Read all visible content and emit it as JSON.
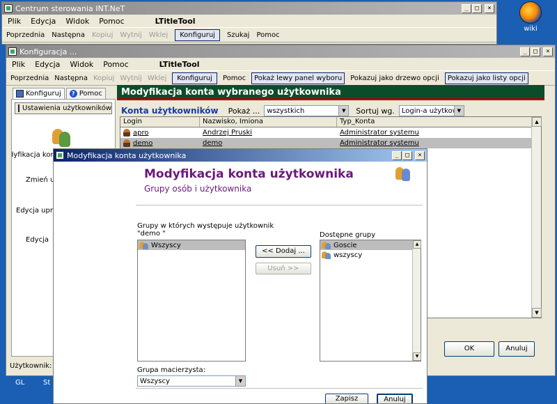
{
  "desktop": {
    "wiki_label": "wiki",
    "taskbar": [
      "GL",
      "St"
    ]
  },
  "back_window": {
    "title": "Centrum sterowania INT.NeT",
    "menu": [
      "Plik",
      "Edycja",
      "Widok",
      "Pomoc"
    ],
    "tool_title": "LTitleTool",
    "toolbar": {
      "prev": "Poprzednia",
      "next": "Następna",
      "copy": "Kopiuj",
      "cut": "Wytnij",
      "paste": "Wklej",
      "configure": "Konfiguruj",
      "search": "Szukaj",
      "help": "Pomoc"
    },
    "window_buttons": {
      "min": "_",
      "max": "□",
      "close": "×"
    }
  },
  "config_window": {
    "title": "Konfiguracja ...",
    "menu": [
      "Plik",
      "Edycja",
      "Widok",
      "Pomoc"
    ],
    "tool_title": "LTitleTool",
    "toolbar": {
      "prev": "Poprzednia",
      "next": "Następna",
      "copy": "Kopiuj",
      "cut": "Wytnij",
      "paste": "Wklej",
      "configure": "Konfiguruj",
      "help": "Pomoc",
      "show_left": "Pokaż lewy panel wyboru",
      "show_tree": "Pokazuj jako drzewo opcji",
      "show_list": "Pokazuj jako listy opcji"
    },
    "tabs": {
      "configure": "Konfiguruj",
      "help": "Pomoc"
    },
    "nav": {
      "header": "Ustawienia użytkowników i g...",
      "items": [
        "dyfikacja konta wybranego użytkowni",
        "Zmień u",
        "Edycja upra",
        "Edycja"
      ]
    },
    "main_header": "Modyfikacja konta wybranego użytkownika",
    "filter": {
      "title": "Konta użytkowników",
      "show_label": "Pokaż ...",
      "show_value": "wszystkich",
      "sort_label": "Sortuj wg.",
      "sort_value": "Login-a użytkownika"
    },
    "grid": {
      "columns": [
        "Login",
        "Nazwisko, Imiona",
        "Typ_Konta"
      ],
      "rows": [
        {
          "login": "apro",
          "name": "Andrzej Pruski",
          "type": "Administrator systemu"
        },
        {
          "login": "demo",
          "name": "demo",
          "type": "Administrator systemu"
        }
      ]
    },
    "ok_label": "OK",
    "cancel_label": "Anuluj",
    "status": "Użytkownik: Jac"
  },
  "dialog": {
    "title": "Modyfikacja konta użytkownika",
    "heading": "Modyfikacja konta użytkownika",
    "subheading": "Grupy osób i użytkownika",
    "member_label_line1": "Grupy w których występuje użytkownik",
    "member_label_line2": "\"demo \"",
    "member_groups": [
      "Wszyscy"
    ],
    "add_label": "<< Dodaj ...",
    "remove_label": "Usuń >>",
    "available_label": "Dostępne grupy",
    "available_groups": [
      "Goscie",
      "wszyscy"
    ],
    "parent_label": "Grupa macierzysta:",
    "parent_value": "Wszyscy",
    "save_label": "Zapisz",
    "cancel_label": "Anuluj"
  }
}
